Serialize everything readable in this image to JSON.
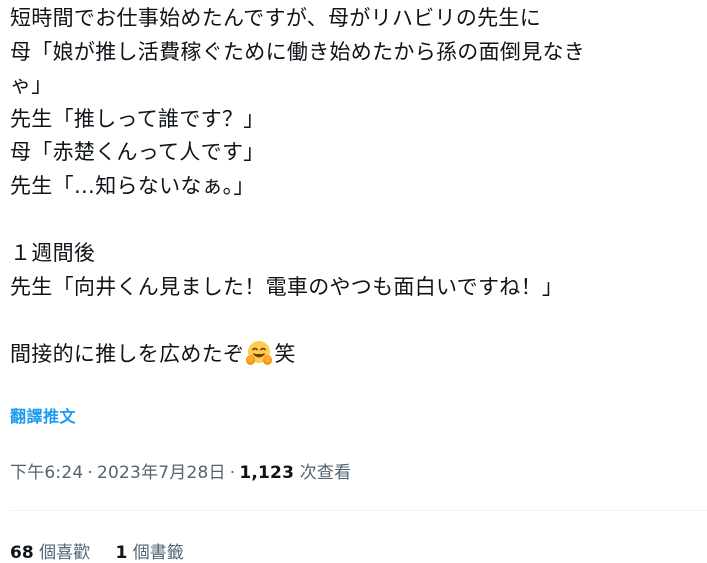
{
  "tweet": {
    "lines": [
      "短時間でお仕事始めたんですが、母がリハビリの先生に",
      "母「娘が推し活費稼ぐために働き始めたから孫の面倒見なき",
      "ゃ」",
      "先生「推しって誰です？」",
      "母「赤楚くんって人です」",
      "先生「…知らないなぁ。」",
      "",
      "１週間後",
      "先生「向井くん見ました！電車のやつも面白いですね！」",
      "",
      "間接的に推しを広めたぞ",
      "笑"
    ],
    "emoji": "smiling-face-with-open-hands"
  },
  "translate_label": "翻譯推文",
  "meta": {
    "time": "下午6:24",
    "separator": "·",
    "date": "2023年7月28日",
    "views_count": "1,123",
    "views_label": "次查看"
  },
  "stats": {
    "likes_count": "68",
    "likes_label": "個喜歡",
    "bookmarks_count": "1",
    "bookmarks_label": "個書籤"
  },
  "colors": {
    "text": "#0f1419",
    "secondary": "#536471",
    "link": "#1d9bf0",
    "divider": "#eff3f4",
    "emoji_face": "#ffcc4d"
  }
}
